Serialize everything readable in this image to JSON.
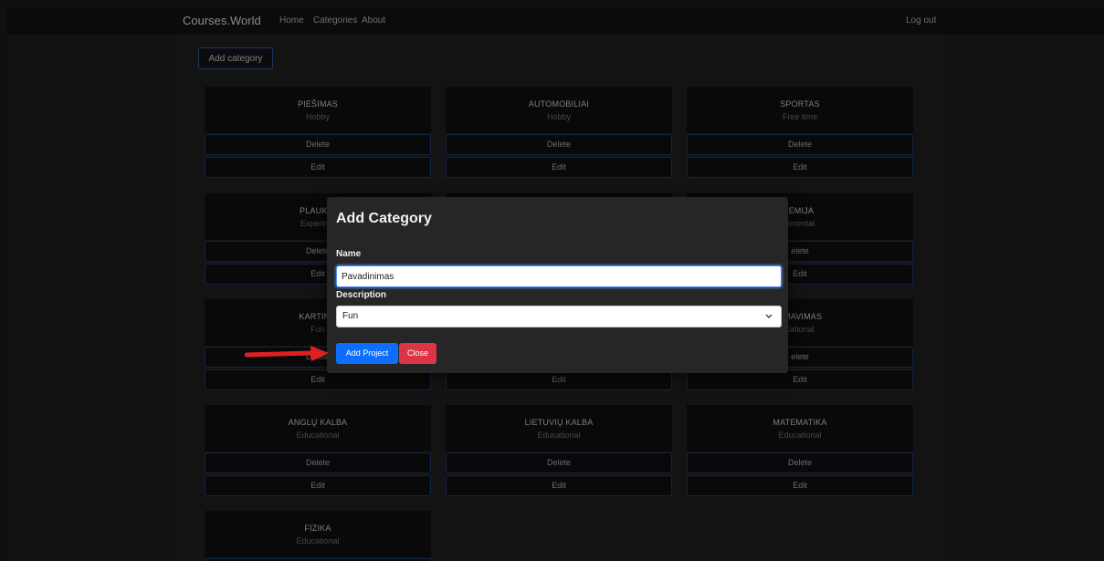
{
  "navbar": {
    "brand": "Courses.World",
    "links": [
      "Home",
      "Categories",
      "About"
    ],
    "logout": "Log out"
  },
  "toolbar": {
    "add_category": "Add category"
  },
  "cards": [
    {
      "title": "PIEŠIMAS",
      "subtitle": "Hobby",
      "delete": "Delete",
      "edit": "Edit"
    },
    {
      "title": "AUTOMOBILIAI",
      "subtitle": "Hobby",
      "delete": "Delete",
      "edit": "Edit"
    },
    {
      "title": "SPORTAS",
      "subtitle": "Free time",
      "delete": "Delete",
      "edit": "Edit"
    },
    {
      "title": "PLAUKIN",
      "subtitle": "Experime",
      "delete": "Delete",
      "edit": "Edit"
    },
    {
      "title": "",
      "subtitle": "",
      "delete": "",
      "edit": ""
    },
    {
      "title": "IEMIJA",
      "subtitle": "rimental",
      "delete": "elete",
      "edit": "Edit"
    },
    {
      "title": "KARTING",
      "subtitle": "Fun",
      "delete": "Delete",
      "edit": "Edit"
    },
    {
      "title": "",
      "subtitle": "",
      "delete": "",
      "edit": "Edit"
    },
    {
      "title": "AMAVIMAS",
      "subtitle": "cational",
      "delete": "elete",
      "edit": "Edit"
    },
    {
      "title": "ANGLŲ KALBA",
      "subtitle": "Educational",
      "delete": "Delete",
      "edit": "Edit"
    },
    {
      "title": "LIETUVIŲ KALBA",
      "subtitle": "Educational",
      "delete": "Delete",
      "edit": "Edit"
    },
    {
      "title": "MATEMATIKA",
      "subtitle": "Educational",
      "delete": "Delete",
      "edit": "Edit"
    },
    {
      "title": "FIZIKA",
      "subtitle": "Educational",
      "delete": "",
      "edit": ""
    }
  ],
  "modal": {
    "title": "Add Category",
    "name_label": "Name",
    "name_value": "Pavadinimas",
    "description_label": "Description",
    "description_selected": "Fun",
    "submit": "Add Project",
    "close": "Close"
  },
  "colors": {
    "accent": "#0d6efd",
    "danger": "#dc3545",
    "annotation_arrow": "#e02020"
  },
  "icons": {
    "select_chevron": "chevron-down-icon",
    "annotation": "arrow-right-icon"
  }
}
